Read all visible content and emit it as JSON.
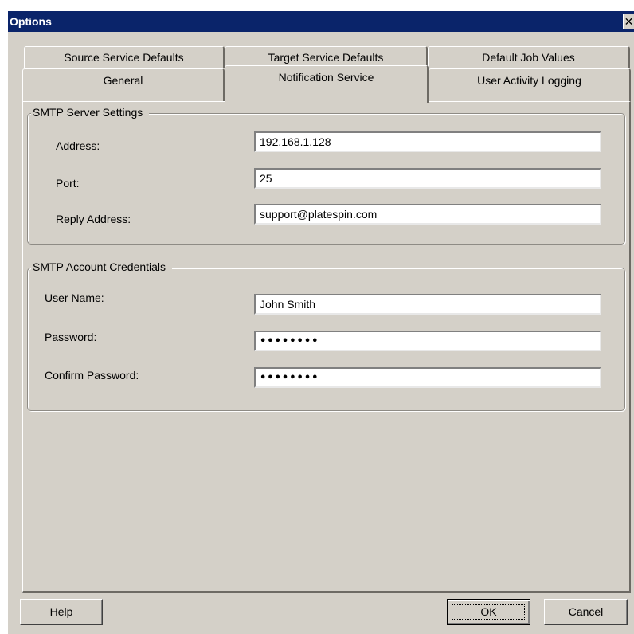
{
  "window": {
    "title": "Options",
    "close_glyph": "✕"
  },
  "tabs": {
    "row_top": [
      {
        "label": "Source Service Defaults"
      },
      {
        "label": "Target Service Defaults"
      },
      {
        "label": "Default Job Values"
      }
    ],
    "row_bottom": [
      {
        "label": "General"
      },
      {
        "label": "Notification Service",
        "selected": true
      },
      {
        "label": "User Activity Logging"
      }
    ]
  },
  "smtp_server": {
    "legend": "SMTP Server Settings",
    "address_label": "Address:",
    "address_value": "192.168.1.128",
    "port_label": "Port:",
    "port_value": "25",
    "reply_label": "Reply Address:",
    "reply_value": "support@platespin.com"
  },
  "smtp_account": {
    "legend": "SMTP Account Credentials",
    "username_label": "User Name:",
    "username_value": "John Smith",
    "password_label": "Password:",
    "password_value": "••••••••",
    "confirm_label": "Confirm Password:",
    "confirm_value": "••••••••"
  },
  "buttons": {
    "help": "Help",
    "ok": "OK",
    "cancel": "Cancel"
  },
  "colors": {
    "title_bar": "#0a246a",
    "face": "#d4d0c8"
  }
}
